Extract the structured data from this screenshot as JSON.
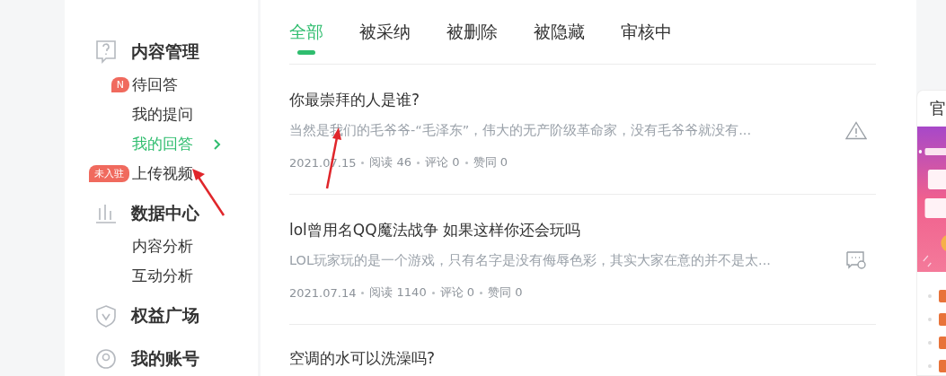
{
  "sidebar": {
    "sections": [
      {
        "kind": "question",
        "title": "内容管理",
        "items": [
          {
            "label": "待回答",
            "badge": "N",
            "selected": false
          },
          {
            "label": "我的提问",
            "selected": false
          },
          {
            "label": "我的回答",
            "selected": true
          },
          {
            "label": "上传视频",
            "badge": "未入驻",
            "selected": false
          }
        ]
      },
      {
        "kind": "chart",
        "title": "数据中心",
        "items": [
          {
            "label": "内容分析",
            "selected": false
          },
          {
            "label": "互动分析",
            "selected": false
          }
        ]
      },
      {
        "kind": "shield",
        "title": "权益广场"
      },
      {
        "kind": "user",
        "title": "我的账号"
      }
    ]
  },
  "tabs": [
    {
      "label": "全部",
      "selected": true
    },
    {
      "label": "被采纳",
      "selected": false
    },
    {
      "label": "被删除",
      "selected": false
    },
    {
      "label": "被隐藏",
      "selected": false
    },
    {
      "label": "审核中",
      "selected": false
    }
  ],
  "answers": [
    {
      "title": "你最崇拜的人是谁?",
      "excerpt": "当然是我们的毛爷爷-“毛泽东”，伟大的无产阶级革命家，没有毛爷爷就没有...",
      "meta": [
        "2021.07.15",
        "阅读 46",
        "评论 0",
        "赞同 0"
      ],
      "kind": "warning"
    },
    {
      "title": "lol曾用名QQ魔法战争 如果这样你还会玩吗",
      "excerpt": "LOL玩家玩的是一个游戏，只有名字是没有侮辱色彩，其实大家在意的并不是太...",
      "meta": [
        "2021.07.14",
        "阅读 1140",
        "评论 0",
        "赞同 0"
      ],
      "kind": "feedback"
    },
    {
      "title": "空调的水可以洗澡吗?"
    }
  ],
  "side_card": {
    "title": "官"
  }
}
